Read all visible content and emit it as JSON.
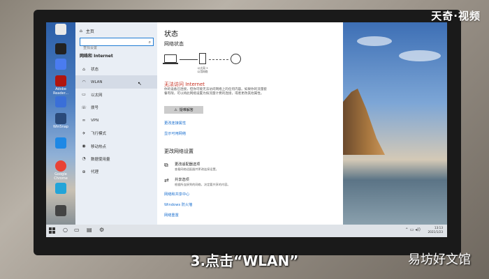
{
  "overlay": {
    "brand": "天奇·视频",
    "caption": "3.点击“WLAN”",
    "watermark": "易坊好文馆"
  },
  "desktop": {
    "icons": [
      {
        "label": "",
        "color": "#e9e9e9"
      },
      {
        "label": "",
        "color": "#222222"
      },
      {
        "label": "",
        "color": "#4a7cf0"
      },
      {
        "label": "Adobe Reader...",
        "color": "#b0150f"
      },
      {
        "label": "",
        "color": "#3a6fd8"
      },
      {
        "label": "WinSnap",
        "color": "#2a4a7a"
      },
      {
        "label": "",
        "color": "#1e88e5"
      },
      {
        "label": "Google Chrome",
        "color": "#e94235"
      },
      {
        "label": "",
        "color": "#23a4d8"
      },
      {
        "label": "",
        "color": "#444444"
      }
    ]
  },
  "settings": {
    "nav": {
      "home_label": "主页",
      "search_placeholder": "查找设置",
      "section_title": "网络和 Internet",
      "items": [
        {
          "label": "状态",
          "icon": "home-icon"
        },
        {
          "label": "WLAN",
          "icon": "wifi-icon"
        },
        {
          "label": "以太网",
          "icon": "ethernet-icon"
        },
        {
          "label": "拨号",
          "icon": "dialup-icon"
        },
        {
          "label": "VPN",
          "icon": "vpn-icon"
        },
        {
          "label": "飞行模式",
          "icon": "airplane-icon"
        },
        {
          "label": "移动热点",
          "icon": "hotspot-icon"
        },
        {
          "label": "数据使用量",
          "icon": "data-usage-icon"
        },
        {
          "label": "代理",
          "icon": "proxy-icon"
        }
      ]
    },
    "content": {
      "title": "状态",
      "subtitle": "网络状态",
      "router_label": "以太网 3\n公用网络",
      "error_title": "无法访问 Internet",
      "error_text": "你的设备已连接，但你可能无法访问网络上的任何内容。如果你的流量套餐有限，可以将此网络设置为按流量计费的连接，或者更改其他属性。",
      "troubleshoot_label": "疑难解答",
      "link_change_props": "更改连接属性",
      "link_show_networks": "显示可用网络",
      "change_title": "更改网络设置",
      "options": [
        {
          "title": "更改适配器选项",
          "desc": "查看网络适配器并更改连接设置。"
        },
        {
          "title": "共享选项",
          "desc": "根据所连接到的网络，决定要共享的内容。"
        }
      ],
      "link_network_center": "网络和共享中心",
      "link_firewall": "Windows 防火墙",
      "link_reset": "网络重置"
    }
  },
  "taskbar": {
    "time": "13:13",
    "date": "2021/1/23"
  }
}
